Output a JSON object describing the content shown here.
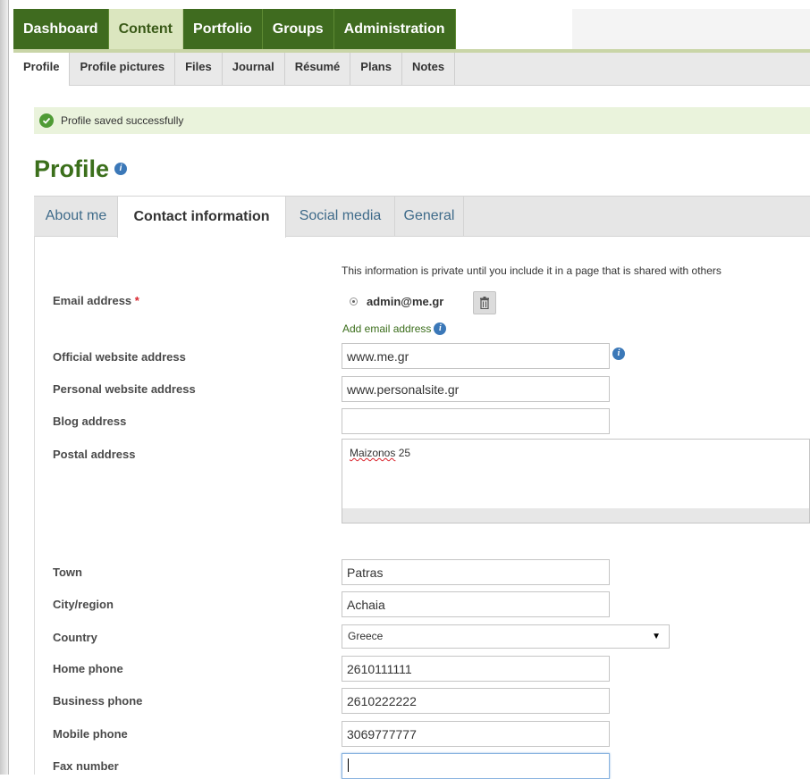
{
  "main_nav": {
    "items": [
      {
        "label": "Dashboard"
      },
      {
        "label": "Content",
        "selected": true
      },
      {
        "label": "Portfolio"
      },
      {
        "label": "Groups"
      },
      {
        "label": "Administration"
      }
    ]
  },
  "sub_nav": {
    "items": [
      {
        "label": "Profile",
        "selected": true
      },
      {
        "label": "Profile pictures"
      },
      {
        "label": "Files"
      },
      {
        "label": "Journal"
      },
      {
        "label": "Résumé"
      },
      {
        "label": "Plans"
      },
      {
        "label": "Notes"
      }
    ]
  },
  "message": {
    "text": "Profile saved successfully",
    "icon": "check-circle-icon",
    "color": "#4f9b35"
  },
  "page": {
    "title": "Profile",
    "info_icon": "info-icon"
  },
  "tabs": [
    {
      "label": "About me"
    },
    {
      "label": "Contact information",
      "selected": true
    },
    {
      "label": "Social media"
    },
    {
      "label": "General"
    }
  ],
  "form": {
    "description": "This information is private until you include it in a page that is shared with others",
    "email": {
      "label": "Email address",
      "required_marker": "*",
      "value": "admin@me.gr",
      "add_link": "Add email address"
    },
    "official_website": {
      "label": "Official website address",
      "value": "www.me.gr"
    },
    "personal_website": {
      "label": "Personal website address",
      "value": "www.personalsite.gr"
    },
    "blog": {
      "label": "Blog address",
      "value": ""
    },
    "postal_address": {
      "label": "Postal address",
      "value_word": "Maizonos",
      "value_rest": " 25"
    },
    "town": {
      "label": "Town",
      "value": "Patras"
    },
    "city_region": {
      "label": "City/region",
      "value": "Achaia"
    },
    "country": {
      "label": "Country",
      "value": "Greece"
    },
    "home_phone": {
      "label": "Home phone",
      "value": "2610111111"
    },
    "business_phone": {
      "label": "Business phone",
      "value": "2610222222"
    },
    "mobile_phone": {
      "label": "Mobile phone",
      "value": "3069777777"
    },
    "fax": {
      "label": "Fax number",
      "value": ""
    }
  },
  "colors": {
    "nav_green": "#3f6b1f",
    "title_green": "#3b6f1b",
    "link_blue": "#3f6b8a",
    "info_blue": "#3b78b8"
  }
}
